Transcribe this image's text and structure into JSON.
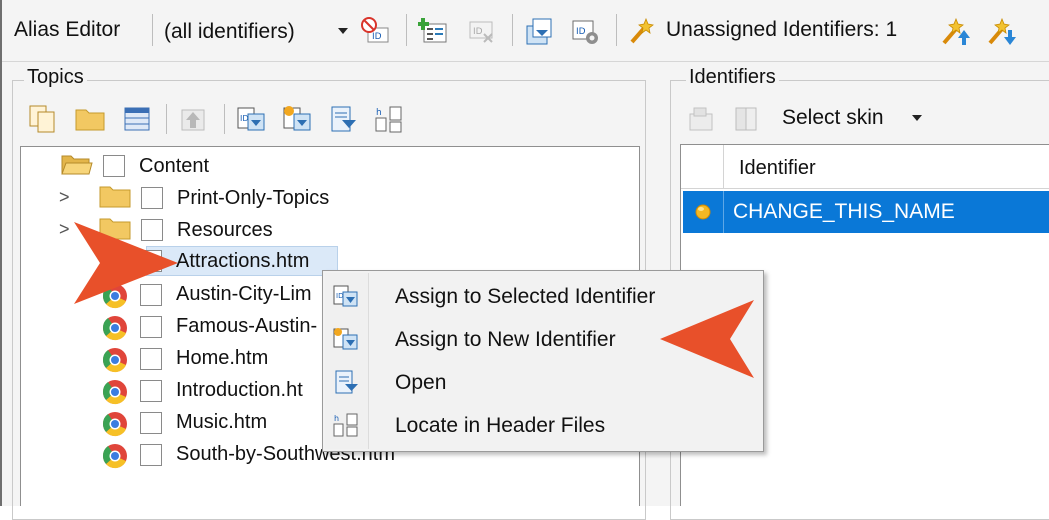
{
  "toolbar": {
    "title": "Alias Editor",
    "filter_value": "(all identifiers)",
    "unassigned_label": "Unassigned Identifiers: 1"
  },
  "topics": {
    "label": "Topics",
    "tree": [
      {
        "label": "Content"
      },
      {
        "label": "Print-Only-Topics"
      },
      {
        "label": "Resources"
      },
      {
        "label": "Attractions.htm"
      },
      {
        "label": "Austin-City-Lim"
      },
      {
        "label": "Famous-Austin-"
      },
      {
        "label": "Home.htm"
      },
      {
        "label": "Introduction.ht"
      },
      {
        "label": "Music.htm"
      },
      {
        "label": "South-by-Southwest.htm"
      }
    ]
  },
  "identifiers": {
    "label": "Identifiers",
    "skin_label": "Select skin",
    "column_header": "Identifier",
    "rows": [
      {
        "name": "CHANGE_THIS_NAME"
      }
    ]
  },
  "context_menu": {
    "items": [
      {
        "label": "Assign to Selected Identifier"
      },
      {
        "label": "Assign to New Identifier"
      },
      {
        "label": "Open"
      },
      {
        "label": "Locate in Header Files"
      }
    ]
  },
  "colors": {
    "selection": "#0a78d7",
    "callout_arrow": "#e8502a",
    "folder": "#f2c862"
  }
}
